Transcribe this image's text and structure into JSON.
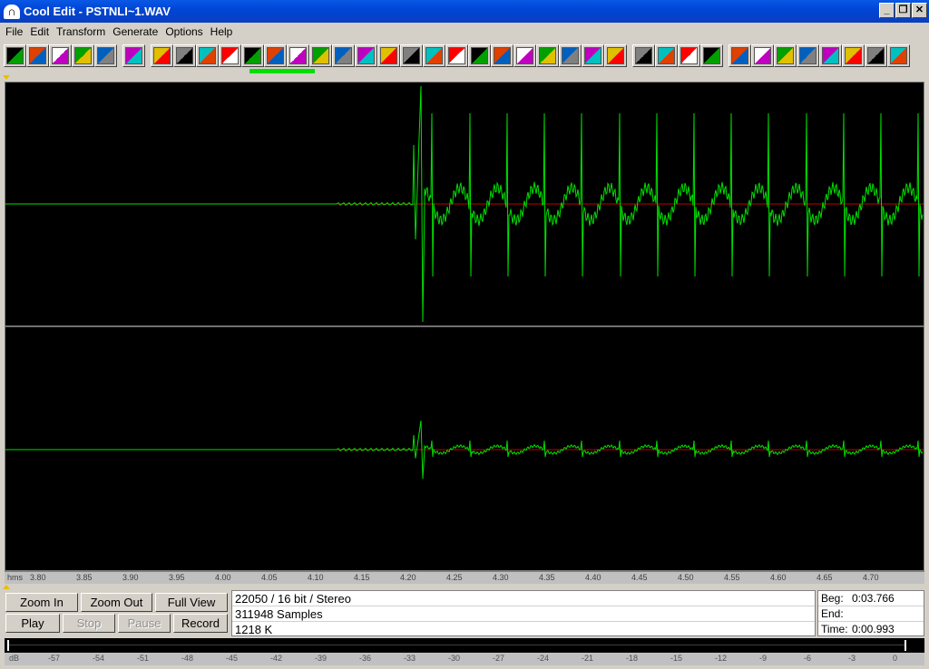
{
  "window": {
    "title": "Cool Edit - PSTNLI~1.WAV",
    "controls": {
      "minimize": "_",
      "restore": "❐",
      "close": "✕"
    }
  },
  "menu": {
    "items": [
      "File",
      "Edit",
      "Transform",
      "Generate",
      "Options",
      "Help"
    ]
  },
  "toolbar": {
    "groups": [
      [
        "new-file-icon",
        "open-file-icon",
        "save-file-icon",
        "mix-paste-icon",
        "open-append-icon"
      ],
      [
        "edit-pencil-icon"
      ],
      [
        "rewind-icon",
        "noise-icon",
        "invert-icon",
        "note-icon",
        "black-dot-icon",
        "stretch-icon",
        "ducks-icon",
        "clock-icon",
        "pattern-icon",
        "fx-icon",
        "delay-icon",
        "fade-icon",
        "envelope-icon",
        "dtmf-icon",
        "filter-icon",
        "spectrum-icon",
        "compress-icon",
        "noise-gen-icon",
        "mesh-icon",
        "bend-icon",
        "wave-icon"
      ],
      [
        "vol-icon",
        "curve-icon",
        "filter2-icon",
        "filter3-icon"
      ],
      [
        "loop-icon",
        "level-icon",
        "marker-icon",
        "zoom-color-icon",
        "cursor-icon",
        "notes-icon",
        "help-icon",
        "cd-icon"
      ]
    ]
  },
  "progress": {
    "fraction": 0.07
  },
  "ruler": {
    "unit": "hms",
    "ticks": [
      "3.80",
      "3.85",
      "3.90",
      "3.95",
      "4.00",
      "4.05",
      "4.10",
      "4.15",
      "4.20",
      "4.25",
      "4.30",
      "4.35",
      "4.40",
      "4.45",
      "4.50",
      "4.55",
      "4.60",
      "4.65",
      "4.70"
    ]
  },
  "buttons": {
    "zoom_in": "Zoom In",
    "zoom_out": "Zoom Out",
    "full_view": "Full View",
    "play": "Play",
    "stop": "Stop",
    "pause": "Pause",
    "record": "Record"
  },
  "info": {
    "format": "22050 / 16 bit / Stereo",
    "samples": "311948 Samples",
    "size": "1218 K"
  },
  "time": {
    "beg_label": "Beg:",
    "beg_value": "0:03.766",
    "end_label": "End:",
    "end_value": "",
    "time_label": "Time:",
    "time_value": "0:00.993"
  },
  "db_scale": {
    "unit": "dB",
    "ticks": [
      "-57",
      "-54",
      "-51",
      "-48",
      "-45",
      "-42",
      "-39",
      "-36",
      "-33",
      "-30",
      "-27",
      "-24",
      "-21",
      "-18",
      "-15",
      "-12",
      "-9",
      "-6",
      "-3",
      "0"
    ]
  },
  "colors": {
    "waveform": "#00e000",
    "center_line": "#c00000",
    "background": "#000000",
    "divider": "#e0e0e0"
  }
}
